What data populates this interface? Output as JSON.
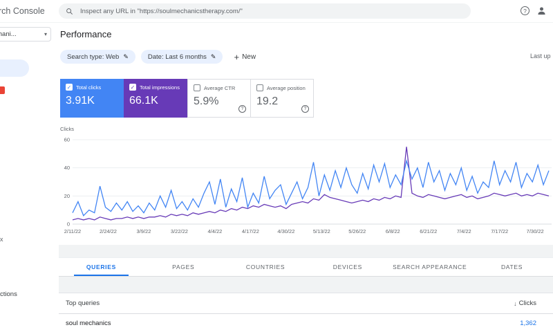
{
  "icons": {
    "help": "?",
    "pencil": "✎",
    "plus": "+",
    "caret": "▾",
    "check": "✓",
    "sort_down": "↓"
  },
  "topbar": {
    "logo_text": "rch Console",
    "search_placeholder": "Inspect any URL in \"https://soulmechanicstherapy.com/\""
  },
  "sidebar": {
    "property_label": "chani...",
    "fragment_index": "x",
    "fragment_actions": "ctions"
  },
  "page": {
    "title": "Performance",
    "chip_search_type": "Search type: Web",
    "chip_date": "Date: Last 6 months",
    "new_button": "New",
    "last_updated": "Last up"
  },
  "cards": {
    "clicks": {
      "label": "Total clicks",
      "value": "3.91K",
      "color": "#4285f4",
      "checked": true
    },
    "impressions": {
      "label": "Total impressions",
      "value": "66.1K",
      "color": "#673ab7",
      "checked": true
    },
    "ctr": {
      "label": "Average CTR",
      "value": "5.9%",
      "checked": false
    },
    "position": {
      "label": "Average position",
      "value": "19.2",
      "checked": false
    }
  },
  "chart_data": {
    "type": "line",
    "ylabel": "Clicks",
    "ylim": [
      0,
      60
    ],
    "yticks": [
      0,
      20,
      40,
      60
    ],
    "grid": "horizontal",
    "legend_position": "none",
    "tick_interval_days": 13,
    "span_days": 174,
    "x_tick_labels": [
      "2/11/22",
      "2/24/22",
      "3/9/22",
      "3/22/22",
      "4/4/22",
      "4/17/22",
      "4/30/22",
      "5/13/22",
      "5/26/22",
      "6/8/22",
      "6/21/22",
      "7/4/22",
      "7/17/22",
      "7/30/22"
    ],
    "series": [
      {
        "name": "Total clicks",
        "color": "#4285f4",
        "values": [
          8,
          16,
          6,
          10,
          8,
          27,
          12,
          9,
          15,
          10,
          16,
          9,
          13,
          8,
          15,
          10,
          20,
          12,
          24,
          11,
          16,
          10,
          18,
          12,
          22,
          30,
          14,
          32,
          12,
          25,
          16,
          33,
          12,
          22,
          15,
          34,
          18,
          24,
          28,
          14,
          22,
          30,
          18,
          26,
          44,
          20,
          35,
          24,
          38,
          26,
          40,
          28,
          22,
          36,
          25,
          42,
          30,
          43,
          26,
          35,
          28,
          45,
          32,
          40,
          26,
          44,
          30,
          38,
          24,
          36,
          28,
          40,
          24,
          34,
          22,
          30,
          26,
          45,
          28,
          38,
          30,
          44,
          26,
          36,
          30,
          42,
          28,
          38
        ]
      },
      {
        "name": "Total impressions (scaled)",
        "color": "#673ab7",
        "values": [
          3,
          4,
          3,
          4,
          3,
          5,
          4,
          3,
          4,
          4,
          5,
          4,
          5,
          4,
          5,
          5,
          6,
          5,
          7,
          6,
          7,
          6,
          8,
          7,
          8,
          9,
          8,
          10,
          9,
          11,
          10,
          12,
          11,
          13,
          12,
          14,
          13,
          12,
          13,
          11,
          14,
          15,
          16,
          15,
          18,
          17,
          21,
          19,
          18,
          17,
          16,
          15,
          16,
          17,
          16,
          18,
          17,
          19,
          18,
          20,
          19,
          55,
          22,
          20,
          19,
          21,
          20,
          19,
          18,
          19,
          20,
          21,
          19,
          20,
          18,
          19,
          20,
          22,
          21,
          20,
          21,
          22,
          20,
          21,
          20,
          22,
          21,
          20
        ]
      }
    ]
  },
  "tabs": {
    "items": [
      "QUERIES",
      "PAGES",
      "COUNTRIES",
      "DEVICES",
      "SEARCH APPEARANCE",
      "DATES"
    ],
    "active": "QUERIES"
  },
  "table": {
    "header": "Top queries",
    "clicks_col": "Clicks",
    "rows": [
      {
        "query": "soul mechanics",
        "clicks": "1,362"
      }
    ]
  },
  "colors": {
    "accent_blue": "#1a73e8",
    "clicks_blue": "#4285f4",
    "impressions_purple": "#673ab7",
    "active_nav_bg": "#e8f0fe"
  }
}
